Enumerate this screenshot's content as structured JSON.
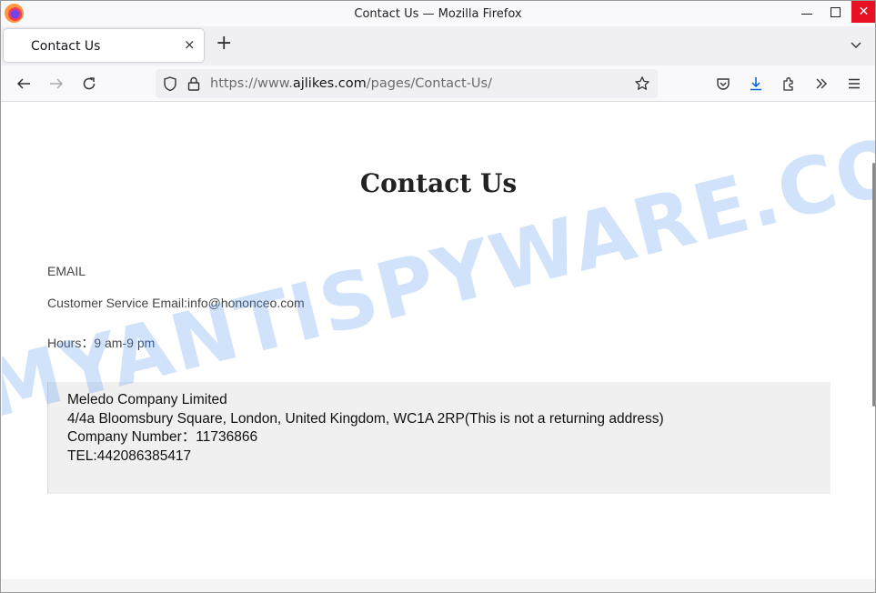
{
  "window": {
    "title": "Contact Us — Mozilla Firefox",
    "controls": {
      "minimize": "minimize",
      "maximize": "maximize",
      "close": "✕"
    }
  },
  "tabs": [
    {
      "label": "Contact Us",
      "active": true,
      "close": "×"
    }
  ],
  "tabstrip": {
    "new_tab": "+"
  },
  "navbar": {
    "url_scheme": "https://www.",
    "url_host": "ajlikes.com",
    "url_path": "/pages/Contact-Us/"
  },
  "page": {
    "title": "Contact Us",
    "email_heading": "EMAIL",
    "email_line": "Customer Service Email:info@hononceo.com",
    "hours_label": "Hours：9 am-9 ",
    "hours_pm": "pm",
    "address": {
      "company": "Meledo Company Limited",
      "street": "4/4a Bloomsbury Square, London, United Kingdom, WC1A 2RP(This is not a returning address)",
      "company_number": "Company Number：11736866",
      "tel": "TEL:442086385417"
    }
  },
  "watermark": "MYANTISPYWARE.COM",
  "colors": {
    "close_button": "#e81123",
    "download_icon": "#0061e0",
    "address_bg": "#f0f0f0"
  }
}
